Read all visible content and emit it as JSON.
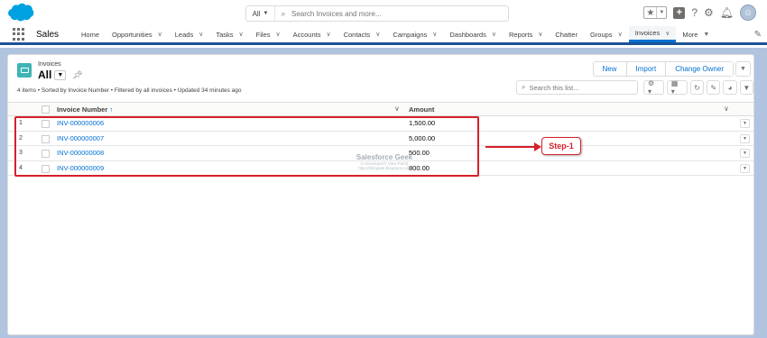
{
  "header": {
    "search_scope": "All",
    "search_placeholder": "Search Invoices and more..."
  },
  "nav": {
    "app_name": "Sales",
    "items": [
      {
        "label": "Home",
        "has_menu": false
      },
      {
        "label": "Opportunities",
        "has_menu": true
      },
      {
        "label": "Leads",
        "has_menu": true
      },
      {
        "label": "Tasks",
        "has_menu": true
      },
      {
        "label": "Files",
        "has_menu": true
      },
      {
        "label": "Accounts",
        "has_menu": true
      },
      {
        "label": "Contacts",
        "has_menu": true
      },
      {
        "label": "Campaigns",
        "has_menu": true
      },
      {
        "label": "Dashboards",
        "has_menu": true
      },
      {
        "label": "Reports",
        "has_menu": true
      },
      {
        "label": "Chatter",
        "has_menu": false
      },
      {
        "label": "Groups",
        "has_menu": true
      },
      {
        "label": "Invoices",
        "has_menu": true,
        "active": true
      },
      {
        "label": "More",
        "has_menu": true
      }
    ]
  },
  "list": {
    "object_type": "Invoices",
    "view_name": "All",
    "info": "4 items • Sorted by Invoice Number • Filtered by all invoices • Updated 34 minutes ago",
    "search_placeholder": "Search this list...",
    "buttons": {
      "new": "New",
      "import": "Import",
      "change_owner": "Change Owner"
    },
    "columns": {
      "invoice_number": "Invoice Number",
      "sort_arrow": "↑",
      "amount": "Amount"
    },
    "rows": [
      {
        "num": "1",
        "invoice": "INV-000000006",
        "amount": "1,500.00"
      },
      {
        "num": "2",
        "invoice": "INV-000000007",
        "amount": "5,000.00"
      },
      {
        "num": "3",
        "invoice": "INV-000000008",
        "amount": "500.00"
      },
      {
        "num": "4",
        "invoice": "INV-000000009",
        "amount": "800.00"
      }
    ]
  },
  "annotation": {
    "step_label": "Step-1"
  },
  "watermark": {
    "title": "Salesforce Geek",
    "subtitle": "(A Developers' View Point)",
    "url": "http://sfdcgeek.blogspot.com"
  },
  "colors": {
    "brand": "#00a1e0",
    "link": "#0070d2",
    "annotation": "#d6202b",
    "object_icon": "#3fb4b5"
  }
}
